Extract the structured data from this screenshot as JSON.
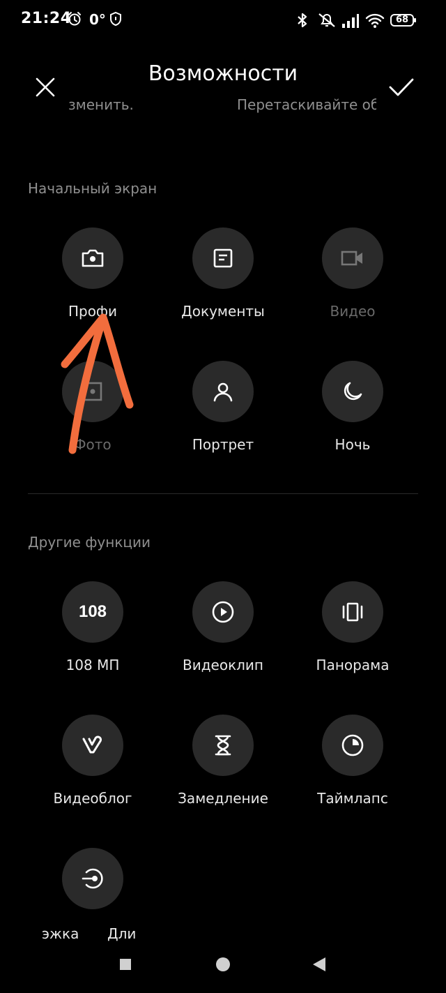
{
  "status_bar": {
    "time": "21:24",
    "temperature": "0°",
    "battery": "68",
    "icons": [
      "alarm-icon",
      "shield-icon",
      "bluetooth-icon",
      "bell-muted-icon",
      "signal-icon",
      "wifi-icon",
      "battery-icon"
    ]
  },
  "header": {
    "title": "Возможности",
    "hint_left": "зменить.",
    "hint_right": "Перетаскивайте об"
  },
  "home_section": {
    "label": "Начальный экран",
    "items": [
      {
        "label": "Профи",
        "icon": "camera-icon"
      },
      {
        "label": "Документы",
        "icon": "document-icon"
      },
      {
        "label": "Видео",
        "icon": "video-icon"
      },
      {
        "label": "Фото",
        "icon": "photo-icon"
      },
      {
        "label": "Портрет",
        "icon": "portrait-icon"
      },
      {
        "label": "Ночь",
        "icon": "moon-icon"
      }
    ]
  },
  "other_section": {
    "label": "Другие функции",
    "items": [
      {
        "label": "108 МП",
        "icon_text": "108",
        "icon": "108mp-icon"
      },
      {
        "label": "Видеоклип",
        "icon": "play-icon"
      },
      {
        "label": "Панорама",
        "icon": "panorama-icon"
      },
      {
        "label": "Видеоблог",
        "icon": "vlog-icon"
      },
      {
        "label": "Замедление",
        "icon": "hourglass-icon"
      },
      {
        "label": "Таймлапс",
        "icon": "timelapse-icon"
      },
      {
        "label_left": "эжка",
        "label_right": "Дли",
        "icon": "long-exposure-icon"
      }
    ]
  },
  "colors": {
    "background": "#000000",
    "tile": "#2a2a2a",
    "muted_text": "#8f8f8f",
    "annotation": "#f26d3d"
  }
}
